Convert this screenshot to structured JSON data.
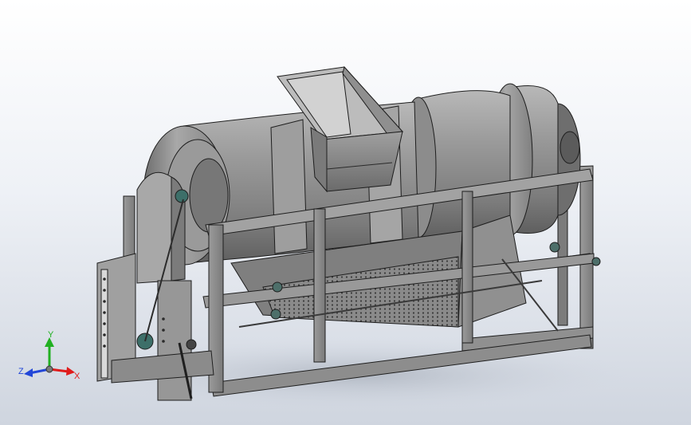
{
  "triad": {
    "x_label": "X",
    "y_label": "Y",
    "z_label": "Z"
  },
  "colors": {
    "background_top": "#ffffff",
    "background_bottom": "#cfd5df",
    "body_steel": "#8f8f8f",
    "body_dark": "#595959",
    "edge": "#1e1e1e",
    "x_axis": "#e01b1b",
    "y_axis": "#21b021",
    "z_axis": "#2246d8"
  },
  "model": {
    "icon": "rotary-drum-separator-icon"
  }
}
